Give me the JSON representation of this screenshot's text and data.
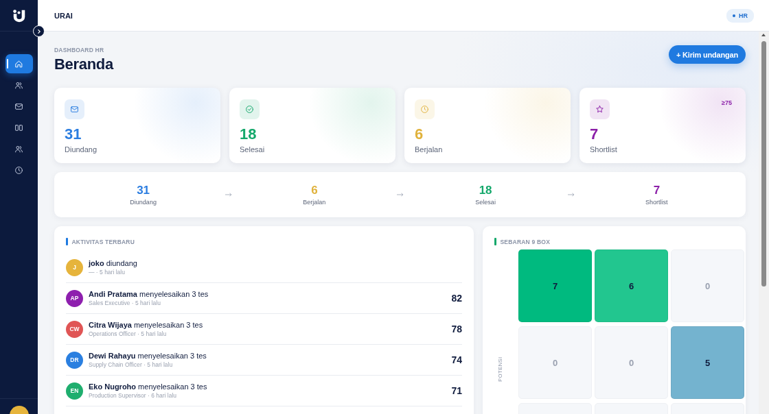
{
  "sidebar": {
    "items": [
      {
        "kind": "home",
        "selected": true
      },
      {
        "kind": "users",
        "selected": false
      },
      {
        "kind": "mail",
        "selected": false
      },
      {
        "kind": "columns",
        "selected": false
      },
      {
        "kind": "users",
        "selected": false
      },
      {
        "kind": "clock",
        "selected": false
      }
    ]
  },
  "topbar": {
    "title": "URAI",
    "role_badge": "HR"
  },
  "header": {
    "eyebrow": "DASHBOARD HR",
    "title": "Beranda",
    "action": "+ Kirim undangan"
  },
  "stat_cards": [
    {
      "kind": "mail",
      "value": "31",
      "label": "Diundang",
      "color": "#2b7de0"
    },
    {
      "kind": "check",
      "value": "18",
      "label": "Selesai",
      "color": "#14a86b"
    },
    {
      "kind": "clock",
      "value": "6",
      "label": "Berjalan",
      "color": "#e0b23c"
    },
    {
      "kind": "star",
      "value": "7",
      "label": "Shortlist",
      "color": "#8b1fa8",
      "badge": "≥75"
    }
  ],
  "funnel": [
    {
      "value": "31",
      "label": "Diundang",
      "color": "#2b7de0"
    },
    {
      "value": "6",
      "label": "Berjalan",
      "color": "#e0b23c"
    },
    {
      "value": "18",
      "label": "Selesai",
      "color": "#14a86b"
    },
    {
      "value": "7",
      "label": "Shortlist",
      "color": "#8b1fa8"
    }
  ],
  "activity": {
    "title": "AKTIVITAS TERBARU",
    "items": [
      {
        "initials": "J",
        "color": "#e6b43c",
        "text": "**joko** diundang",
        "subtitle": "— · 5 hari lalu"
      },
      {
        "initials": "AP",
        "color": "#8e1fae",
        "text": "**Andi Pratama** menyelesaikan 3 tes",
        "subtitle": "Sales Executive · 5 hari lalu",
        "score": "82"
      },
      {
        "initials": "CW",
        "color": "#e05555",
        "text": "**Citra Wijaya** menyelesaikan 3 tes",
        "subtitle": "Operations Officer · 5 hari lalu",
        "score": "78"
      },
      {
        "initials": "DR",
        "color": "#2a7fe0",
        "text": "**Dewi Rahayu** menyelesaikan 3 tes",
        "subtitle": "Supply Chain Officer · 5 hari lalu",
        "score": "74"
      },
      {
        "initials": "EN",
        "color": "#1fae6e",
        "text": "**Eko Nugroho** menyelesaikan 3 tes",
        "subtitle": "Production Supervisor · 6 hari lalu",
        "score": "71"
      }
    ]
  },
  "nine_box": {
    "title": "SEBARAN 9 BOX",
    "axis_label": "POTENSI",
    "cells": [
      {
        "value": "7",
        "color": "#00ba7f"
      },
      {
        "value": "6",
        "color": "#22c68f"
      },
      {
        "value": "0",
        "color": "#f5f7fa"
      },
      {
        "value": "0",
        "color": "#f5f7fa"
      },
      {
        "value": "0",
        "color": "#f5f7fa"
      },
      {
        "value": "5",
        "color": "#74b3cf"
      },
      {
        "color": "#f5f7fa"
      },
      {
        "color": "#f5f7fa"
      },
      {
        "color": "#f5f7fa"
      }
    ]
  }
}
